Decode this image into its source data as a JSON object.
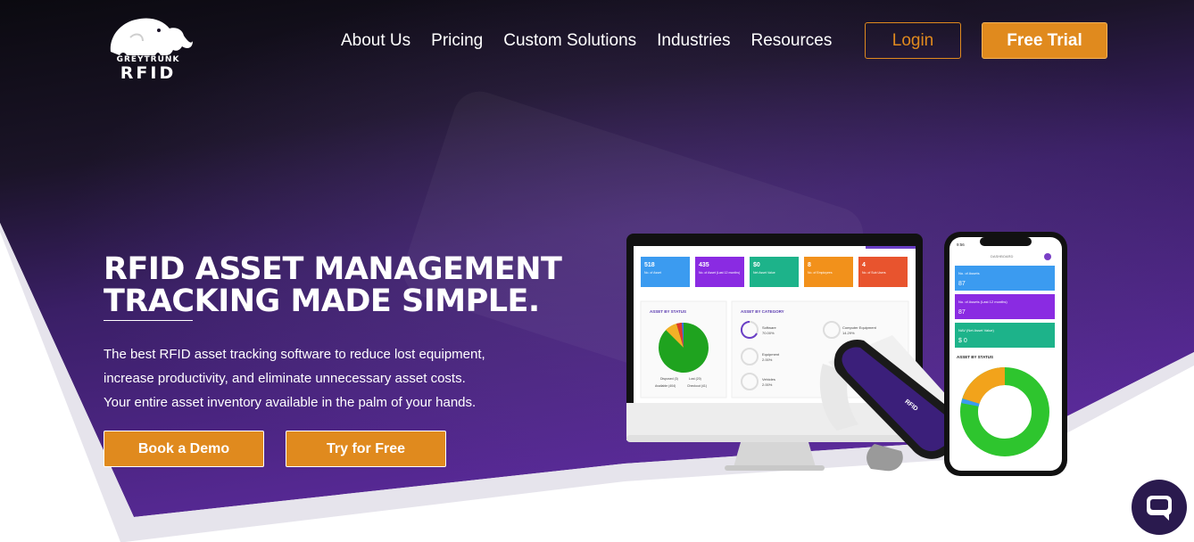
{
  "brand": {
    "name_top": "GREYTRUNK",
    "name_bottom": "RFID",
    "logo_icon": "elephant-icon"
  },
  "nav": {
    "items": [
      {
        "label": "About Us"
      },
      {
        "label": "Pricing"
      },
      {
        "label": "Custom Solutions"
      },
      {
        "label": "Industries"
      },
      {
        "label": "Resources"
      }
    ],
    "login_label": "Login",
    "trial_label": "Free Trial"
  },
  "hero": {
    "headline_line1": "RFID ASSET MANAGEMENT",
    "headline_line2": "TRACKING MADE SIMPLE.",
    "sub_line1": "The best RFID asset tracking software to reduce lost equipment,",
    "sub_line2": "increase productivity, and eliminate unnecessary asset costs.",
    "sub_line3": "Your entire asset inventory available in the palm of your hands.",
    "demo_label": "Book a Demo",
    "free_label": "Try for Free"
  },
  "dashboard": {
    "cards": [
      {
        "value": "518",
        "label": "No. of Asset",
        "color": "#3b9bf0"
      },
      {
        "value": "435",
        "label": "No. of Asset (Last 12 months)",
        "color": "#8a2be2"
      },
      {
        "value": "$0",
        "label": "Net Asset Value",
        "color": "#1db38a"
      },
      {
        "value": "8",
        "label": "No. of Employees",
        "color": "#f2911b"
      },
      {
        "value": "4",
        "label": "No. of Sub Users",
        "color": "#e8542e"
      }
    ],
    "status_title": "ASSET BY STATUS",
    "category_title": "ASSET BY CATEGORY",
    "legend": [
      "Disposed (3)",
      "Lost (20)",
      "Available (404)",
      "Checkout (41)"
    ],
    "categories": [
      {
        "name": "Software",
        "pct": "70.00%"
      },
      {
        "name": "Computer Equipment",
        "pct": "14.29%"
      },
      {
        "name": "Equipment",
        "pct": "2.00%"
      },
      {
        "name": "Vehicles",
        "pct": "2.00%"
      }
    ]
  },
  "phone": {
    "time": "9:56",
    "title": "DASHBOARD",
    "cards": [
      {
        "label": "No. of Assets",
        "value": "87",
        "color": "#3b9bf0"
      },
      {
        "label": "No. of Assets (Last 12 months)",
        "value": "87",
        "color": "#8a2be2"
      },
      {
        "label": "NAV (Net Asset Value)",
        "value": "$ 0",
        "color": "#1db38a"
      }
    ],
    "status_title": "ASSET BY STATUS"
  },
  "scanner": {
    "brand_text": "RFID"
  },
  "chat": {
    "icon": "chat-bubble-icon"
  },
  "colors": {
    "accent": "#e08a1e",
    "hero_purple": "#4a2480",
    "header_dark": "#0e0b16"
  }
}
